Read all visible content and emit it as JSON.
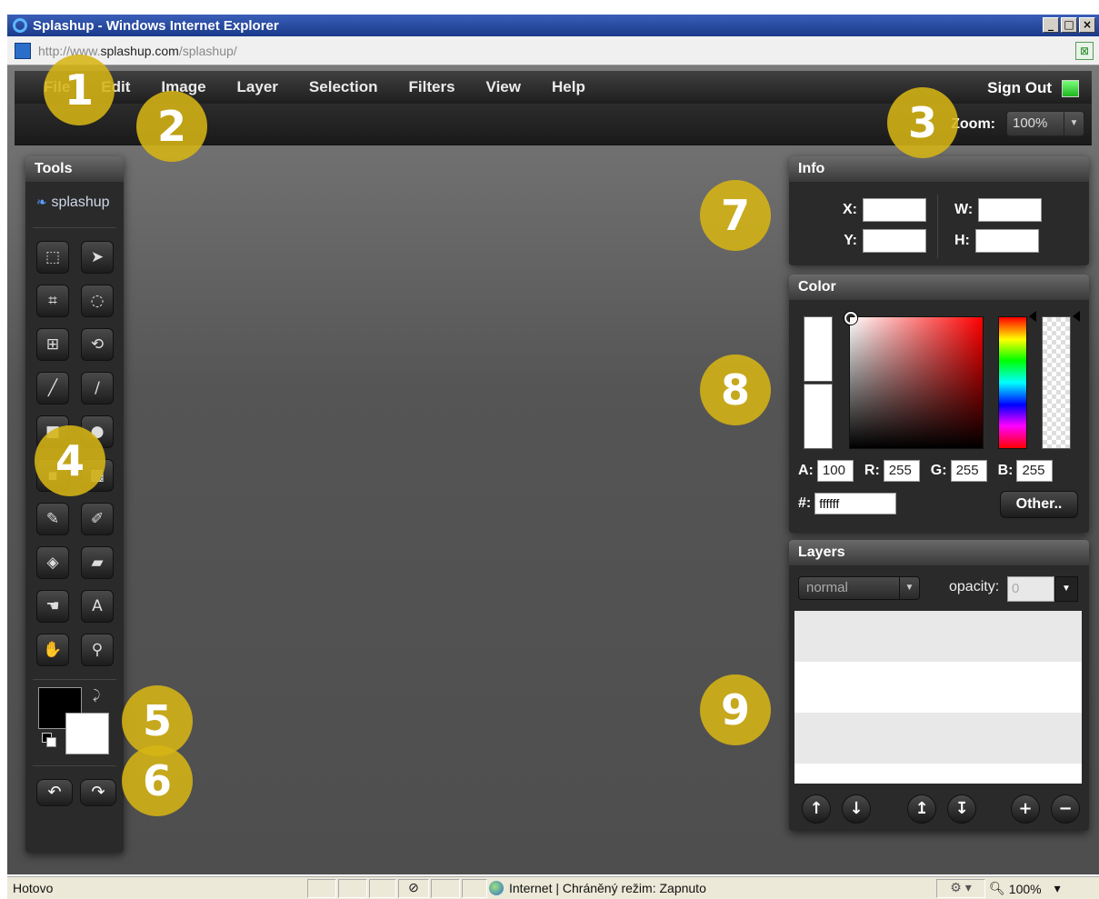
{
  "browser": {
    "title": "Splashup - Windows Internet Explorer",
    "url_prefix": "http://www.",
    "url_domain": "splashup.com",
    "url_path": "/splashup/",
    "controls": {
      "minimize": "_",
      "maximize": "□",
      "close": "×"
    }
  },
  "menu": {
    "items": [
      "File",
      "Edit",
      "Image",
      "Layer",
      "Selection",
      "Filters",
      "View",
      "Help"
    ],
    "sign_out": "Sign Out",
    "status_color": "#2ec42e"
  },
  "zoom": {
    "label": "Zoom:",
    "value": "100%"
  },
  "tools": {
    "title": "Tools",
    "logo": "splashup",
    "icons": [
      "marquee-select-icon",
      "pointer-move-icon",
      "crop-icon",
      "lasso-icon",
      "transform-icon",
      "rotate-transform-icon",
      "brush-icon",
      "line-icon",
      "rectangle-shape-icon",
      "ellipse-shape-icon",
      "fill-rect-icon",
      "stamp-icon",
      "pencil-icon",
      "paintbrush-icon",
      "paint-bucket-icon",
      "eraser-icon",
      "smudge-icon",
      "text-icon",
      "hand-pan-icon",
      "eyedropper-icon"
    ],
    "text_tool_label": "A",
    "foreground_color": "#000000",
    "background_color": "#ffffff"
  },
  "info": {
    "title": "Info",
    "x_label": "X:",
    "y_label": "Y:",
    "w_label": "W:",
    "h_label": "H:"
  },
  "color": {
    "title": "Color",
    "a_label": "A:",
    "a_value": "100",
    "r_label": "R:",
    "r_value": "255",
    "g_label": "G:",
    "g_value": "255",
    "b_label": "B:",
    "b_value": "255",
    "hex_label": "#:",
    "hex_value": "ffffff",
    "other_label": "Other.."
  },
  "layers": {
    "title": "Layers",
    "blend_mode": "normal",
    "opacity_label": "opacity:",
    "opacity_value": "0"
  },
  "callouts": [
    "1",
    "2",
    "3",
    "4",
    "5",
    "6",
    "7",
    "8",
    "9"
  ],
  "statusbar": {
    "status": "Hotovo",
    "zone": "Internet | Chráněný režim: Zapnuto",
    "zoom": "100%"
  }
}
